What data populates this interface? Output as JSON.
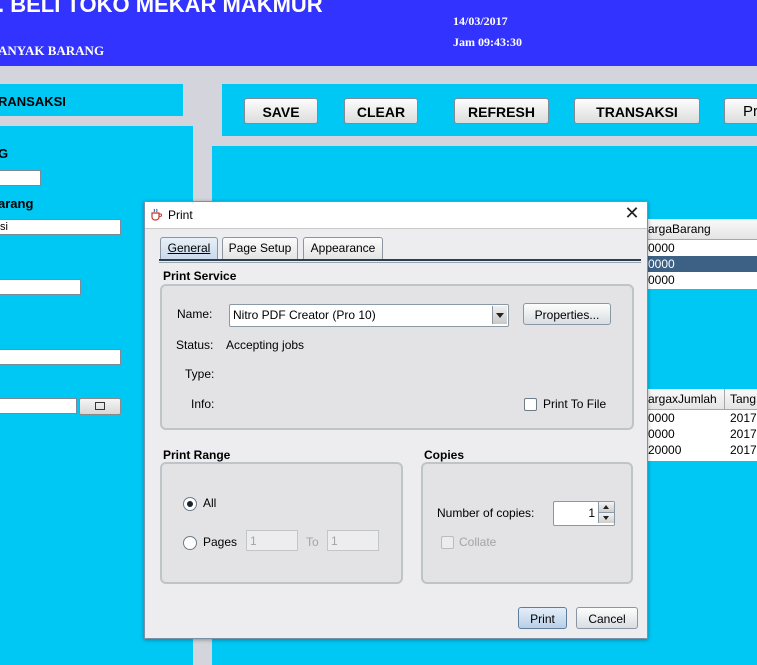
{
  "app": {
    "header": {
      "title": ". BELI TOKO MEKAR MAKMUR",
      "subtitle": "ANYAK BARANG",
      "date": "14/03/2017",
      "time": "Jam 09:43:30"
    },
    "left_panel": {
      "section_title": "RANSAKSI",
      "label_1": "G",
      "label_2": "arang",
      "field_2_value": "si"
    },
    "toolbar": {
      "save_label": "SAVE",
      "clear_label": "CLEAR",
      "refresh_label": "REFRESH",
      "transaksi_label": "TRANSAKSI",
      "print_label": "Pr"
    },
    "table_barang": {
      "header": "argaBarang",
      "rows": [
        "0000",
        "0000",
        "0000"
      ]
    },
    "table_transaksi": {
      "headers": [
        "argaxJumlah",
        "Tang"
      ],
      "rows": [
        [
          "0000",
          "2017"
        ],
        [
          "0000",
          "2017"
        ],
        [
          "20000",
          "2017"
        ]
      ]
    }
  },
  "dialog": {
    "title": "Print",
    "tabs": [
      "General",
      "Page Setup",
      "Appearance"
    ],
    "print_service": {
      "section_label": "Print Service",
      "name_label": "Name:",
      "printer": "Nitro PDF Creator (Pro 10)",
      "properties_button": "Properties...",
      "status_label": "Status:",
      "status_value": "Accepting jobs",
      "type_label": "Type:",
      "info_label": "Info:",
      "print_to_file_label": "Print To File"
    },
    "print_range": {
      "section_label": "Print Range",
      "all_label": "All",
      "pages_label": "Pages",
      "from_value": "1",
      "to_label": "To",
      "to_value": "1"
    },
    "copies": {
      "section_label": "Copies",
      "number_label": "Number of copies:",
      "number_value": "1",
      "collate_label": "Collate"
    },
    "print_button": "Print",
    "cancel_button": "Cancel"
  }
}
